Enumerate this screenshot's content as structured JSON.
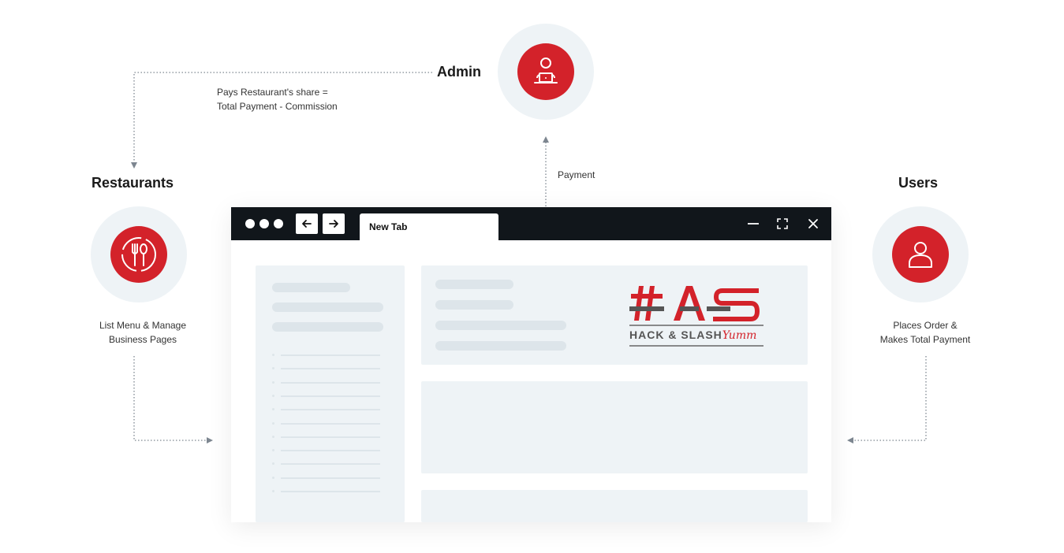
{
  "nodes": {
    "admin": {
      "title": "Admin"
    },
    "restaurants": {
      "title": "Restaurants",
      "note_line1": "List Menu & Manage",
      "note_line2": "Business Pages"
    },
    "users": {
      "title": "Users",
      "note_line1": "Places Order &",
      "note_line2": "Makes Total Payment"
    }
  },
  "edges": {
    "admin_to_restaurants": {
      "line1": "Pays Restaurant's share =",
      "line2": "Total Payment - Commission"
    },
    "browser_to_admin": {
      "label": "Payment"
    }
  },
  "browser": {
    "tab_label": "New Tab",
    "logo_text_main": "HACK & SLASH",
    "logo_text_script": "Yumm"
  },
  "colors": {
    "accent": "#d3222a",
    "halo": "#eef3f6",
    "bar": "#11161b",
    "skeleton": "#dde5ea"
  },
  "icons": [
    "admin-laptop-user-icon",
    "fork-spoon-icon",
    "user-icon",
    "back-arrow-icon",
    "forward-arrow-icon",
    "minimize-icon",
    "maximize-icon",
    "close-icon"
  ]
}
